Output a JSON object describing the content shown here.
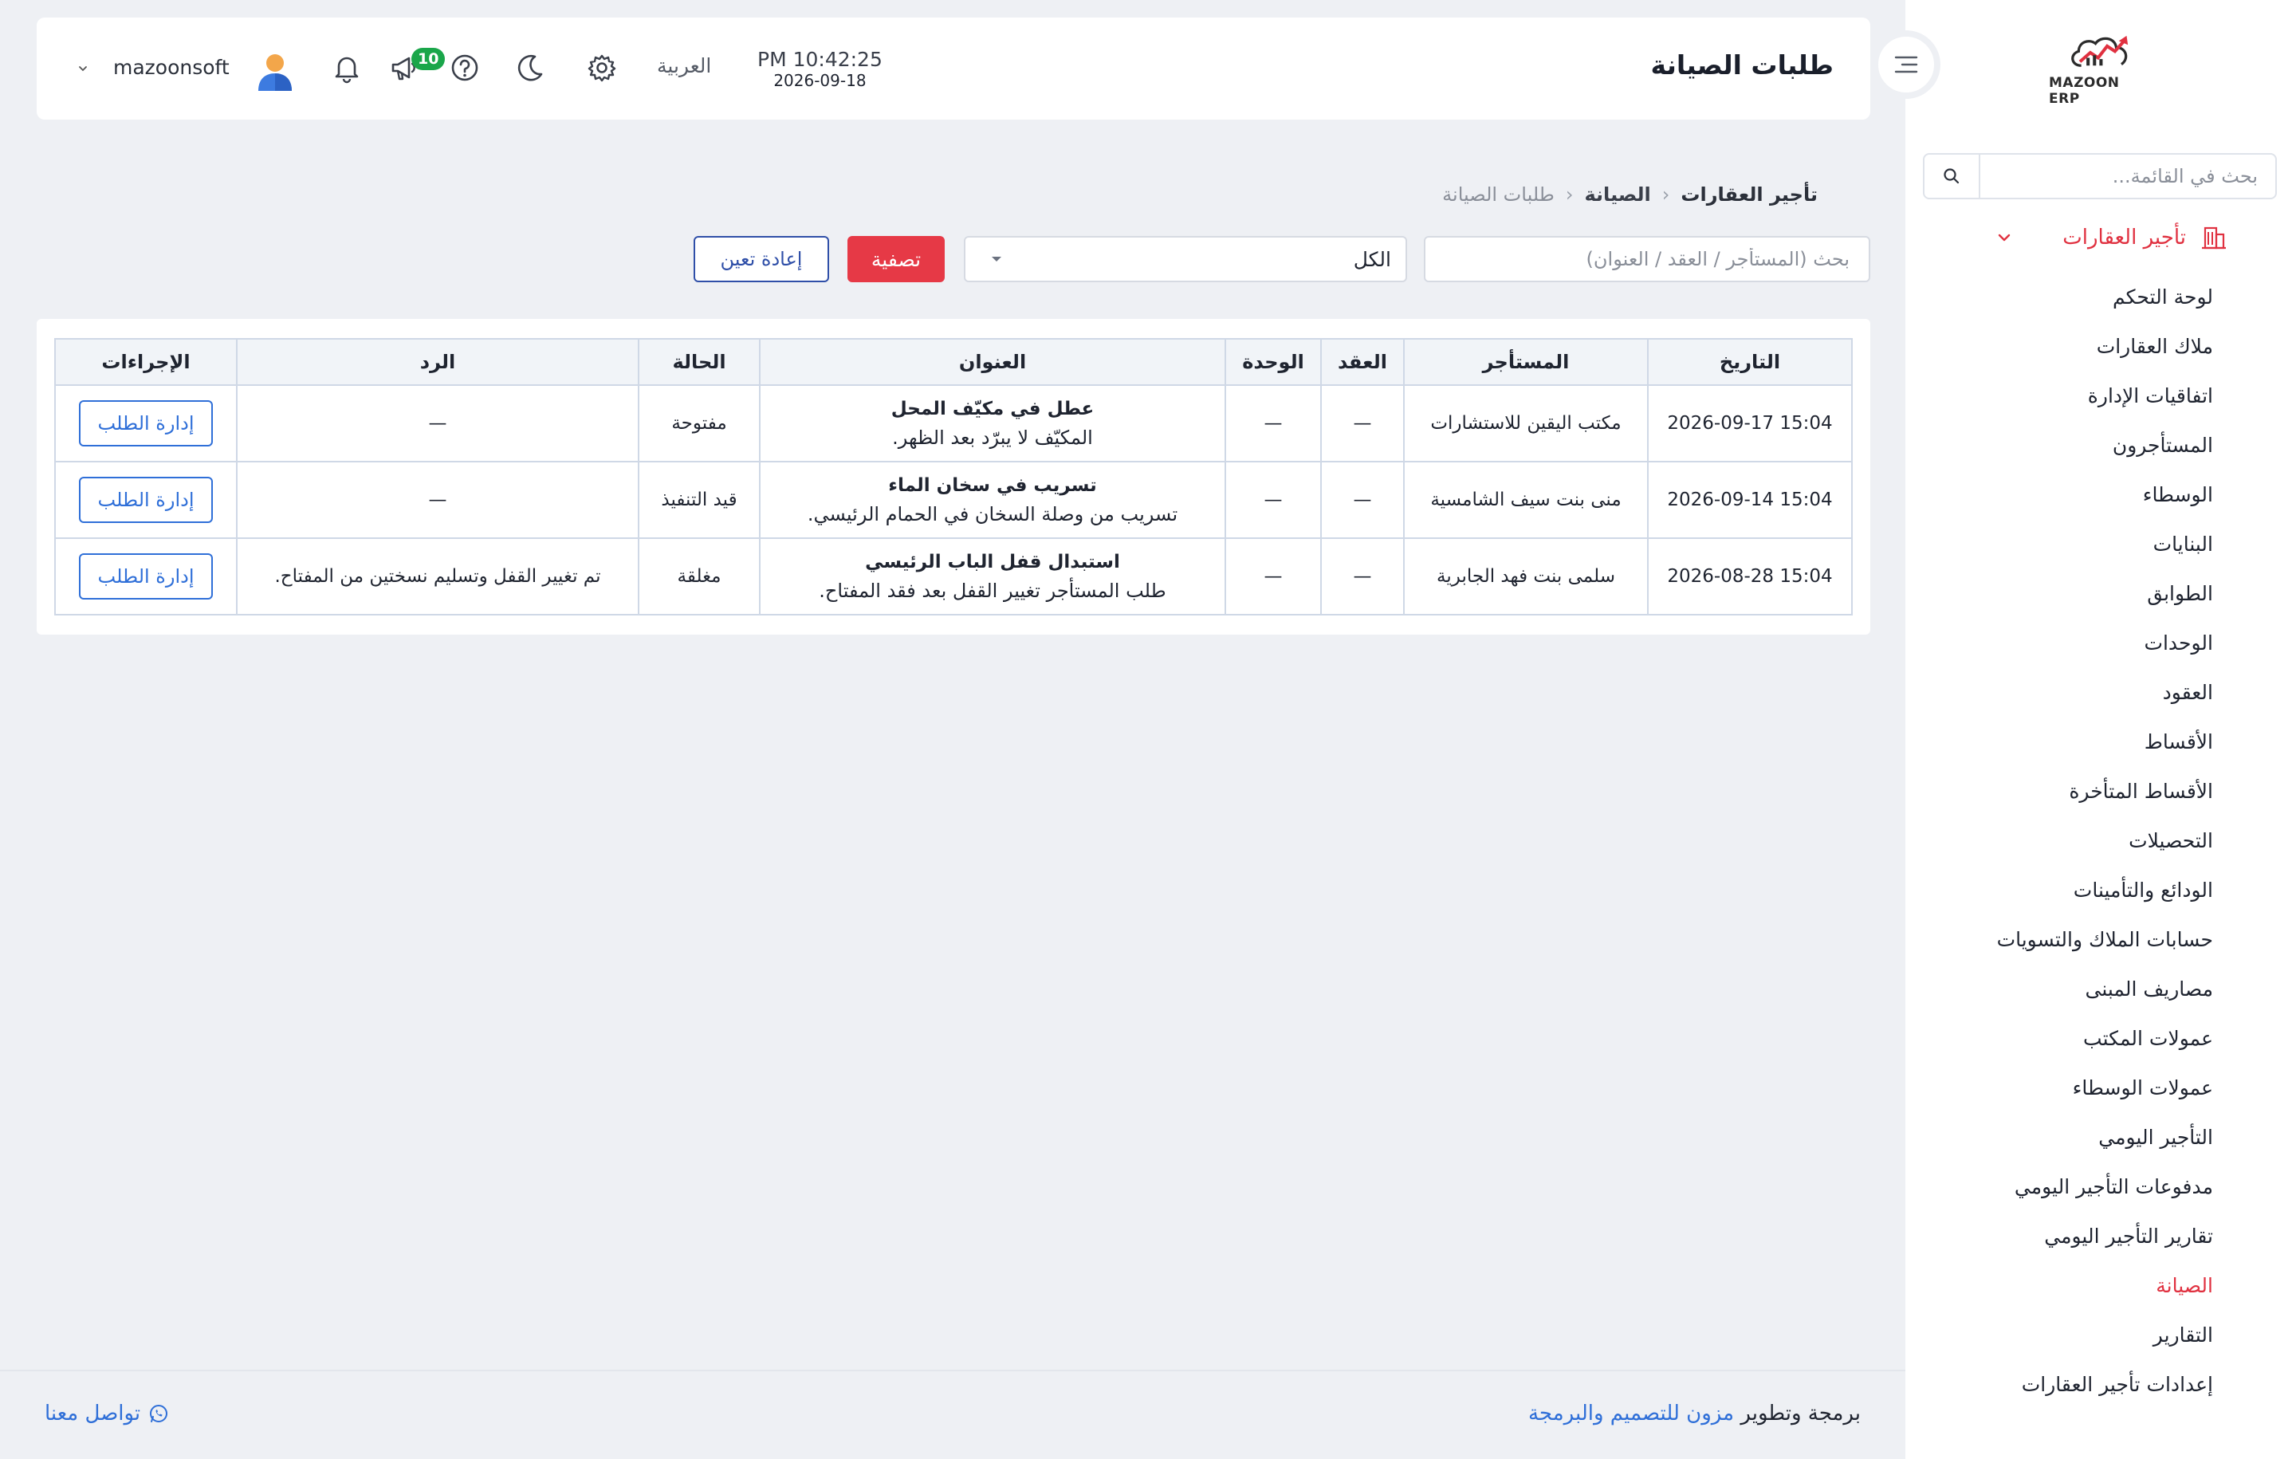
{
  "brand": {
    "logo_text": "MAZOON ERP",
    "logo_sub": "ERP/ERP"
  },
  "header": {
    "title": "طلبات الصيانة",
    "time": "PM 10:42:25",
    "date": "2026-09-18",
    "language": "العربية",
    "notification_count": "10",
    "username": "mazoonsoft"
  },
  "sidebar": {
    "search_placeholder": "بحث في القائمة...",
    "group_label": "تأجير العقارات",
    "items": [
      {
        "label": "لوحة التحكم"
      },
      {
        "label": "ملاك العقارات"
      },
      {
        "label": "اتفاقيات الإدارة"
      },
      {
        "label": "المستأجرون"
      },
      {
        "label": "الوسطاء"
      },
      {
        "label": "البنايات"
      },
      {
        "label": "الطوابق"
      },
      {
        "label": "الوحدات"
      },
      {
        "label": "العقود"
      },
      {
        "label": "الأقساط"
      },
      {
        "label": "الأقساط المتأخرة"
      },
      {
        "label": "التحصيلات"
      },
      {
        "label": "الودائع والتأمينات"
      },
      {
        "label": "حسابات الملاك والتسويات"
      },
      {
        "label": "مصاريف المبنى"
      },
      {
        "label": "عمولات المكتب"
      },
      {
        "label": "عمولات الوسطاء"
      },
      {
        "label": "التأجير اليومي"
      },
      {
        "label": "مدفوعات التأجير اليومي"
      },
      {
        "label": "تقارير التأجير اليومي"
      },
      {
        "label": "الصيانة",
        "active": true
      },
      {
        "label": "التقارير"
      },
      {
        "label": "إعدادات تأجير العقارات"
      }
    ]
  },
  "breadcrumb": {
    "root": "تأجير العقارات",
    "section": "الصيانة",
    "current": "طلبات الصيانة"
  },
  "filters": {
    "search_placeholder": "بحث (المستأجر / العقد / العنوان)",
    "status_value": "الكل",
    "filter_label": "تصفية",
    "reset_label": "إعادة تعين"
  },
  "table": {
    "headers": {
      "date": "التاريخ",
      "tenant": "المستأجر",
      "contract": "العقد",
      "unit": "الوحدة",
      "title": "العنوان",
      "status": "الحالة",
      "reply": "الرد",
      "actions": "الإجراءات"
    },
    "rows": [
      {
        "date": "2026-09-17 15:04",
        "tenant": "مكتب اليقين للاستشارات",
        "contract": "—",
        "unit": "—",
        "title": "عطل في مكيّف المحل",
        "description": "المكيّف لا يبرّد بعد الظهر.",
        "status": "مفتوحة",
        "reply": "—",
        "action": "إدارة الطلب"
      },
      {
        "date": "2026-09-14 15:04",
        "tenant": "منى بنت سيف الشامسية",
        "contract": "—",
        "unit": "—",
        "title": "تسريب في سخان الماء",
        "description": "تسريب من وصلة السخان في الحمام الرئيسي.",
        "status": "قيد التنفيذ",
        "reply": "—",
        "action": "إدارة الطلب"
      },
      {
        "date": "2026-08-28 15:04",
        "tenant": "سلمى بنت فهد الجابرية",
        "contract": "—",
        "unit": "—",
        "title": "استبدال قفل الباب الرئيسي",
        "description": "طلب المستأجر تغيير القفل بعد فقد المفتاح.",
        "status": "مغلقة",
        "reply": "تم تغيير القفل وتسليم نسختين من المفتاح.",
        "action": "إدارة الطلب"
      }
    ]
  },
  "footer": {
    "credit_prefix": "برمجة وتطوير",
    "credit_link": "مزون للتصميم والبرمجة",
    "contact": "تواصل معنا"
  },
  "colors": {
    "accent_red": "#e63946",
    "link_blue": "#2f6fd8",
    "badge_green": "#1aa64a"
  }
}
